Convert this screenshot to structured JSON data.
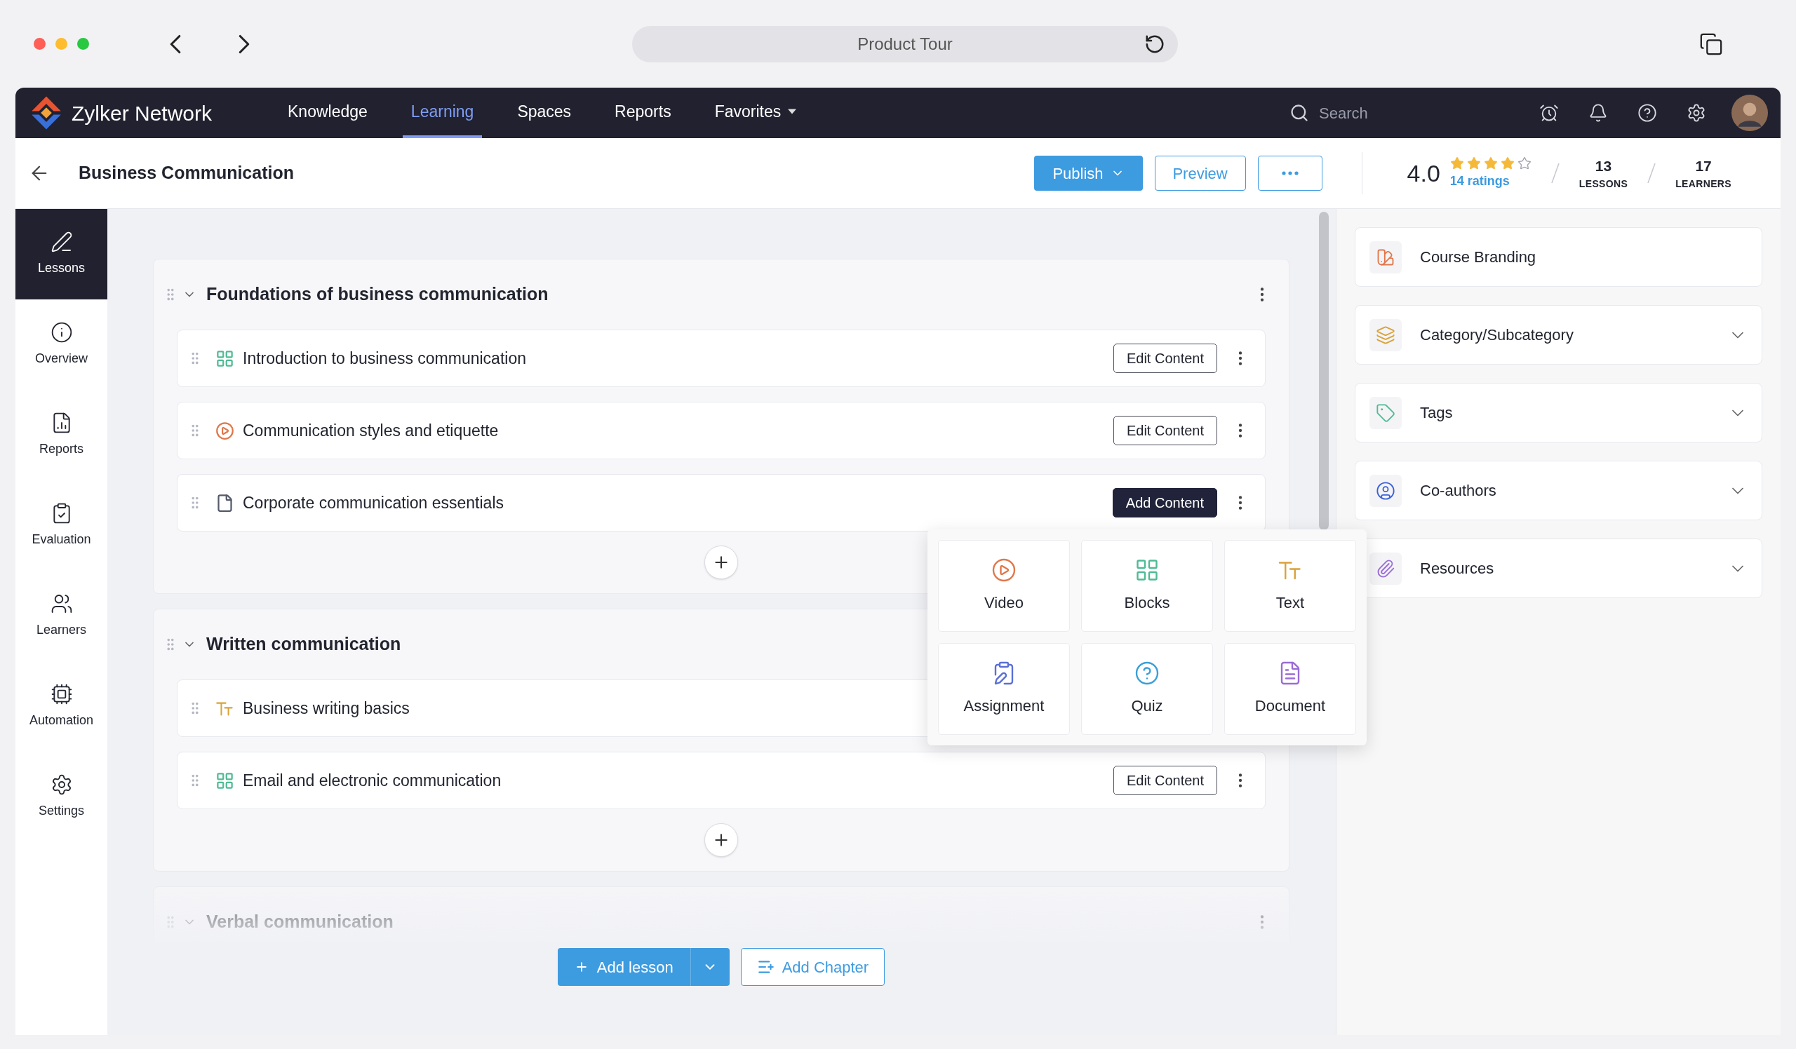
{
  "browser": {
    "title": "Product Tour"
  },
  "topbar": {
    "brand": "Zylker Network",
    "nav": [
      {
        "label": "Knowledge",
        "selected": false,
        "has_menu": false
      },
      {
        "label": "Learning",
        "selected": true,
        "has_menu": false
      },
      {
        "label": "Spaces",
        "selected": false,
        "has_menu": false
      },
      {
        "label": "Reports",
        "selected": false,
        "has_menu": false
      },
      {
        "label": "Favorites",
        "selected": false,
        "has_menu": true
      }
    ],
    "search": {
      "placeholder": "Search"
    }
  },
  "header": {
    "title": "Business Communication",
    "publish": "Publish",
    "preview": "Preview",
    "rating": "4.0",
    "stars": 4,
    "ratings_link": "14 ratings",
    "stats": [
      {
        "value": "13",
        "label": "LESSONS"
      },
      {
        "value": "17",
        "label": "LEARNERS"
      }
    ]
  },
  "sidebar": {
    "items": [
      {
        "kind": "lessons",
        "label": "Lessons",
        "selected": true
      },
      {
        "kind": "overview",
        "label": "Overview",
        "selected": false
      },
      {
        "kind": "reports",
        "label": "Reports",
        "selected": false
      },
      {
        "kind": "evaluation",
        "label": "Evaluation",
        "selected": false
      },
      {
        "kind": "learners",
        "label": "Learners",
        "selected": false
      },
      {
        "kind": "automation",
        "label": "Automation",
        "selected": false
      },
      {
        "kind": "settings",
        "label": "Settings",
        "selected": false
      }
    ]
  },
  "chapters": [
    {
      "title": "Foundations of business communication",
      "expanded": true,
      "lessons": [
        {
          "kind": "blocks",
          "title": "Introduction to business communication",
          "action": {
            "label": "Edit Content",
            "primary": false
          }
        },
        {
          "kind": "video",
          "title": "Communication styles and etiquette",
          "action": {
            "label": "Edit Content",
            "primary": false
          }
        },
        {
          "kind": "document",
          "title": "Corporate communication essentials",
          "action": {
            "label": "Add Content",
            "primary": true
          }
        }
      ]
    },
    {
      "title": "Written communication",
      "expanded": true,
      "lessons": [
        {
          "kind": "text",
          "title": "Business writing basics"
        },
        {
          "kind": "blocks",
          "title": "Email and electronic communication",
          "action": {
            "label": "Edit Content",
            "primary": false
          }
        }
      ]
    },
    {
      "title": "Verbal communication",
      "expanded": true
    }
  ],
  "content_menu": {
    "options": [
      {
        "kind": "video",
        "label": "Video"
      },
      {
        "kind": "blocks",
        "label": "Blocks"
      },
      {
        "kind": "text",
        "label": "Text"
      },
      {
        "kind": "assignment",
        "label": "Assignment"
      },
      {
        "kind": "quiz",
        "label": "Quiz"
      },
      {
        "kind": "document",
        "label": "Document"
      }
    ]
  },
  "footer": {
    "add_lesson": "Add lesson",
    "add_chapter": "Add Chapter"
  },
  "settings_panel": {
    "items": [
      {
        "kind": "branding",
        "label": "Course Branding",
        "expandable": false
      },
      {
        "kind": "category",
        "label": "Category/Subcategory",
        "expandable": true
      },
      {
        "kind": "tags",
        "label": "Tags",
        "expandable": true
      },
      {
        "kind": "coauthors",
        "label": "Co-authors",
        "expandable": true
      },
      {
        "kind": "resources",
        "label": "Resources",
        "expandable": true
      }
    ]
  }
}
